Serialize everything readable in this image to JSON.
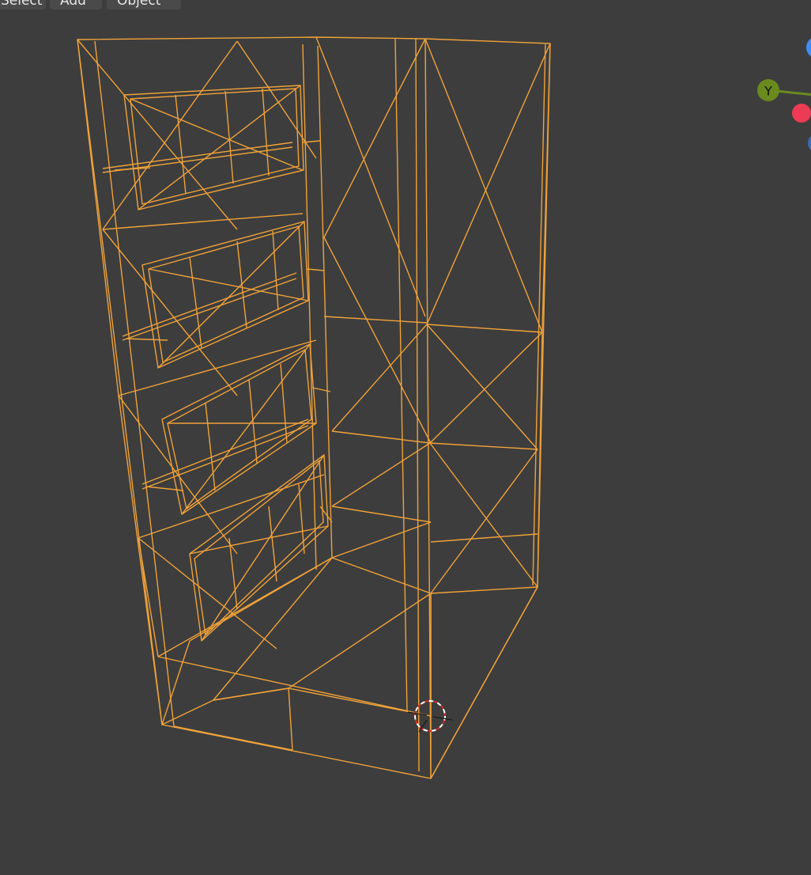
{
  "header_menu": {
    "select_label": "Select",
    "add_label": "Add",
    "object_label": "Object"
  },
  "viewport": {
    "background_color": "#3d3d3d",
    "wireframe_color": "#f0a23a",
    "shading": "wireframe",
    "selected_object": "building-mesh"
  },
  "navigation_gizmo": {
    "y_axis_label": "Y",
    "y_color": "#6a8a1f",
    "x_color": "#ee3b55",
    "z_color": "#3d8df5"
  },
  "cursor_3d": {
    "icon": "3d-cursor-icon"
  }
}
